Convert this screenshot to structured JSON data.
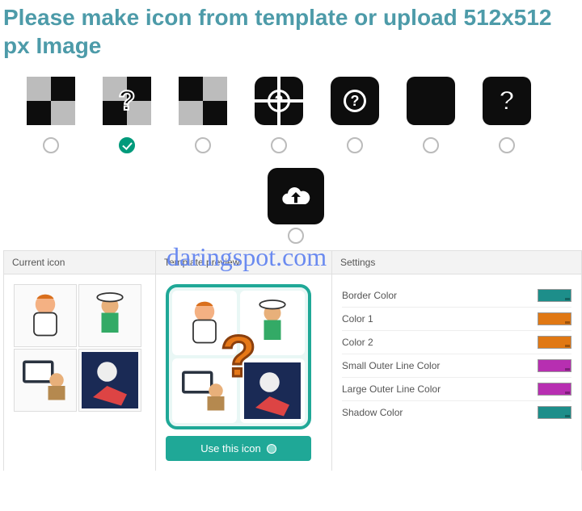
{
  "title": "Please make icon from template or upload 512x512 px Image",
  "watermark": "daringspot.com",
  "templates": {
    "selectedIndex": 1,
    "count": 7
  },
  "panels": {
    "current": "Current icon",
    "preview": "Template preview",
    "settings": "Settings"
  },
  "useBtn": "Use this icon",
  "settings": [
    {
      "label": "Border Color",
      "color": "#1d8e8a"
    },
    {
      "label": "Color 1",
      "color": "#e07814"
    },
    {
      "label": "Color 2",
      "color": "#e07814"
    },
    {
      "label": "Small Outer Line Color",
      "color": "#b72fb1"
    },
    {
      "label": "Large Outer Line Color",
      "color": "#b72fb1"
    },
    {
      "label": "Shadow Color",
      "color": "#1d8e8a"
    }
  ]
}
